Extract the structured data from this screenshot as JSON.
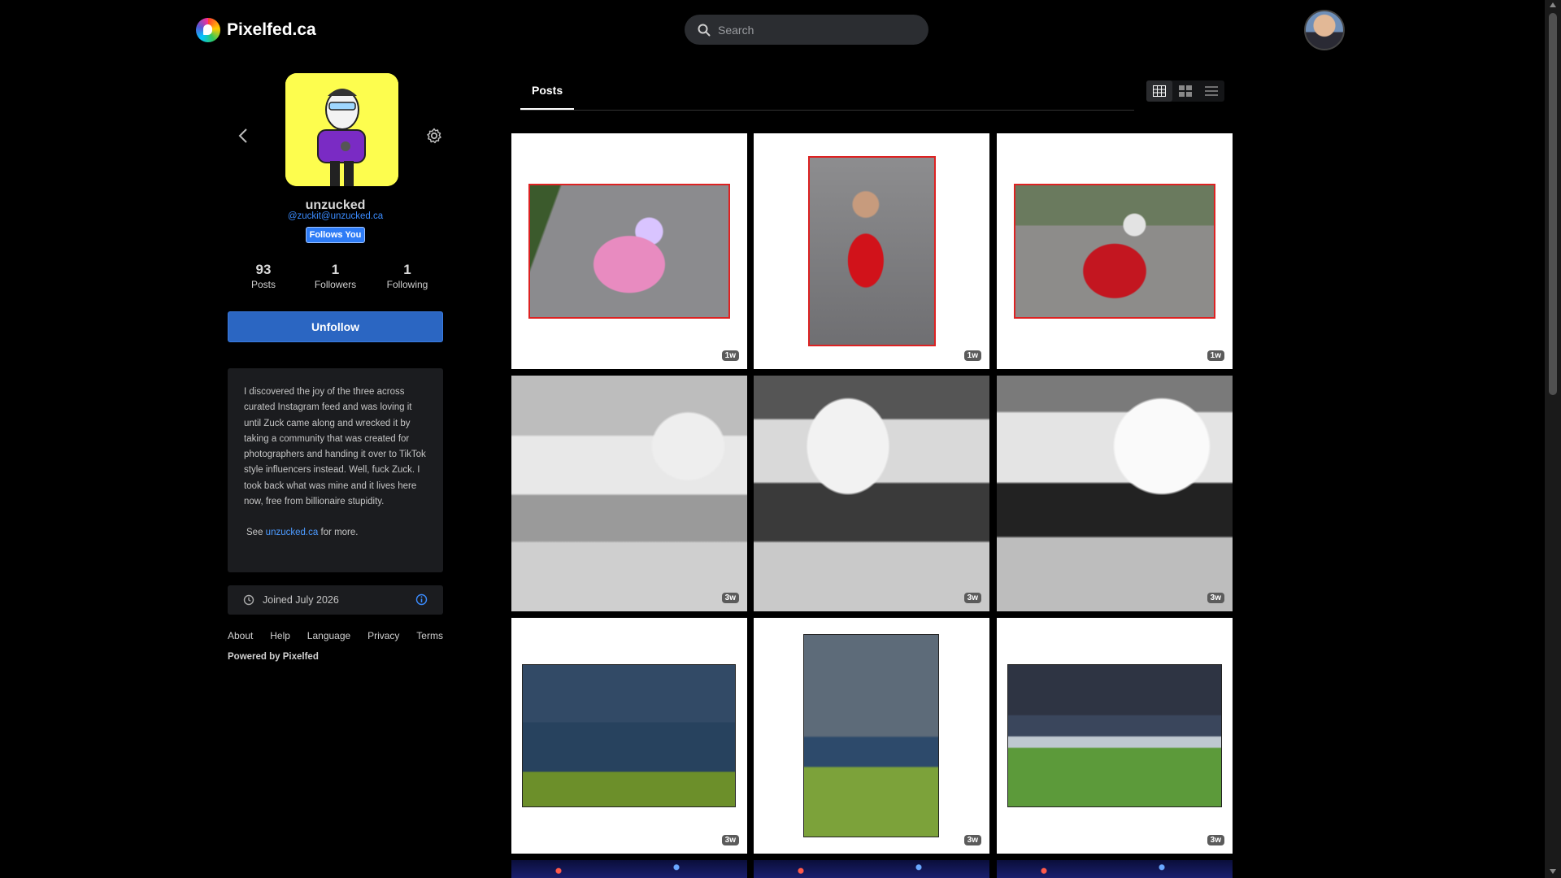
{
  "nav": {
    "brand": "Pixelfed.ca",
    "search_placeholder": "Search"
  },
  "profile": {
    "display_name": "unzucked",
    "handle": "@zuckit@unzucked.ca",
    "badge": "Follows You",
    "stats": [
      {
        "value": "93",
        "label": "Posts"
      },
      {
        "value": "1",
        "label": "Followers"
      },
      {
        "value": "1",
        "label": "Following"
      }
    ],
    "action_label": "Unfollow",
    "bio": "I discovered the joy of the three across curated Instagram feed and was loving it until Zuck came along and wrecked it by taking a community that was created for photographers and handing it over to TikTok style influencers instead. Well, fuck Zuck. I took back what was mine and it lives here now, free from billionaire stupidity.",
    "bio_more_prefix": "See",
    "bio_link": "unzucked.ca",
    "bio_more_suffix": "for more.",
    "joined": "Joined July 2026"
  },
  "footer": {
    "links": [
      "About",
      "Help",
      "Language",
      "Privacy",
      "Terms"
    ],
    "powered": "Powered by Pixelfed"
  },
  "tabs": {
    "posts": "Posts"
  },
  "posts": [
    {
      "time": "1w",
      "kind": "chalk"
    },
    {
      "time": "1w",
      "kind": "girl"
    },
    {
      "time": "1w",
      "kind": "wagon"
    },
    {
      "time": "3w",
      "kind": "ir1"
    },
    {
      "time": "3w",
      "kind": "ir2"
    },
    {
      "time": "3w",
      "kind": "ir3"
    },
    {
      "time": "3w",
      "kind": "storm1"
    },
    {
      "time": "3w",
      "kind": "fence"
    },
    {
      "time": "3w",
      "kind": "bench"
    },
    {
      "time": "",
      "kind": "fire"
    },
    {
      "time": "",
      "kind": "fire"
    },
    {
      "time": "",
      "kind": "fire"
    }
  ],
  "colors": {
    "accent": "#2b66c2",
    "link": "#3b8cff",
    "panel": "#1b1c1f"
  }
}
